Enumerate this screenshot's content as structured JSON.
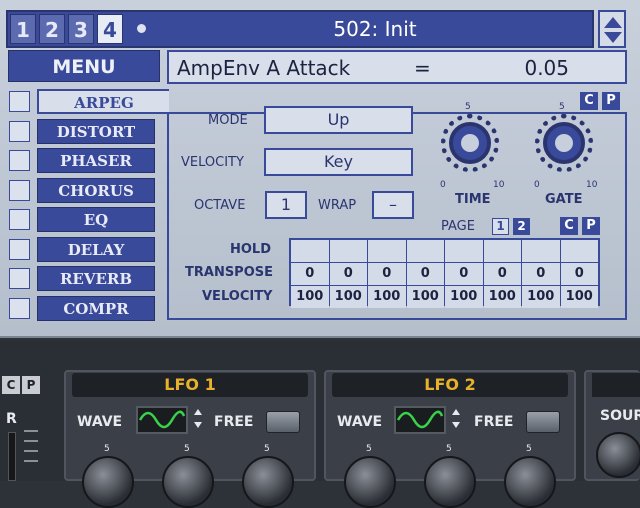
{
  "header": {
    "tabs": [
      "1",
      "2",
      "3",
      "4"
    ],
    "active_tab": "4",
    "patch_name": "502: Init"
  },
  "menu_label": "MENU",
  "param_display": {
    "name": "AmpEnv A Attack",
    "eq": "=",
    "value": "0.05"
  },
  "fx_buttons": [
    "ARPEG",
    "DISTORT",
    "PHASER",
    "CHORUS",
    "EQ",
    "DELAY",
    "REVERB",
    "COMPR"
  ],
  "active_fx": "ARPEG",
  "cp": {
    "c": "C",
    "p": "P"
  },
  "arpeggiator": {
    "mode_label": "MODE",
    "mode_value": "Up",
    "velocity_label": "VELOCITY",
    "velocity_value": "Key",
    "octave_label": "OCTAVE",
    "octave_value": "1",
    "wrap_label": "WRAP",
    "wrap_value": "–",
    "page_label": "PAGE",
    "pages": [
      "1",
      "2"
    ],
    "knobs": [
      {
        "label": "TIME",
        "min": "0",
        "mid": "5",
        "max": "10"
      },
      {
        "label": "GATE",
        "min": "0",
        "mid": "5",
        "max": "10"
      }
    ],
    "row_labels": [
      "HOLD",
      "TRANSPOSE",
      "VELOCITY"
    ],
    "hold": [
      "",
      "",
      "",
      "",
      "",
      "",
      "",
      ""
    ],
    "transpose": [
      "0",
      "0",
      "0",
      "0",
      "0",
      "0",
      "0",
      "0"
    ],
    "velocity": [
      "100",
      "100",
      "100",
      "100",
      "100",
      "100",
      "100",
      "100"
    ]
  },
  "lower": {
    "cp": {
      "c": "C",
      "p": "P"
    },
    "r_label": "R",
    "lfo1": {
      "title": "LFO 1",
      "wave_label": "WAVE",
      "free_label": "FREE"
    },
    "lfo2": {
      "title": "LFO 2",
      "wave_label": "WAVE",
      "free_label": "FREE"
    },
    "source_label": "SOUR",
    "knob_tick": "5"
  },
  "colors": {
    "lcd_bg": "#bcc6d4",
    "accent": "#3a4a9a",
    "lfo_title": "#e8b12a",
    "wave": "#39d24a"
  }
}
